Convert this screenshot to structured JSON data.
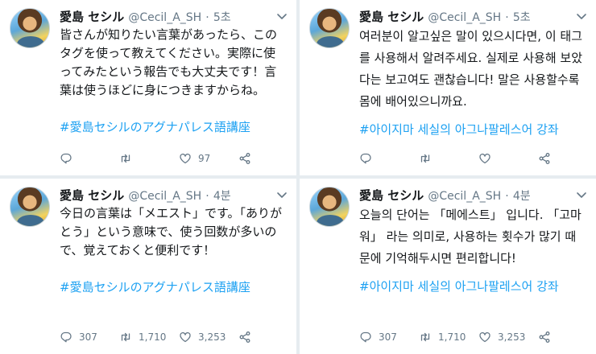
{
  "tweets": [
    {
      "name": "愛島 セシル",
      "handle": "@Cecil_A_SH",
      "dot": "·",
      "time": "5초",
      "lang": "ja",
      "text": "皆さんが知りたい言葉があったら、このタグを使って教えてください。実際に使ってみたという報告でも大丈夫です！言葉は使うほどに身につきますからね。",
      "hashtag": "#愛島セシルのアグナパレス語講座",
      "reply": "",
      "retweet": "",
      "like": "97"
    },
    {
      "name": "愛島 セシル",
      "handle": "@Cecil_A_SH",
      "dot": "·",
      "time": "5초",
      "lang": "ko",
      "text": "여러분이 알고싶은 말이 있으시다면, 이 태그를 사용해서 알려주세요. 실제로 사용해 보았다는 보고여도 괜찮습니다! 말은 사용할수록 몸에 배어있으니까요.",
      "hashtag": "#아이지마 세실의 아그나팔레스어 강좌",
      "reply": "",
      "retweet": "",
      "like": ""
    },
    {
      "name": "愛島 セシル",
      "handle": "@Cecil_A_SH",
      "dot": "·",
      "time": "4분",
      "lang": "ja",
      "text": "今日の言葉は「メエスト」です。「ありがとう」という意味で、使う回数が多いので、覚えておくと便利です！",
      "hashtag": "#愛島セシルのアグナパレス語講座",
      "reply": "307",
      "retweet": "1,710",
      "like": "3,253"
    },
    {
      "name": "愛島 セシル",
      "handle": "@Cecil_A_SH",
      "dot": "·",
      "time": "4분",
      "lang": "ko",
      "text": "오늘의 단어는 「메에스트」 입니다. 「고마워」 라는 의미로, 사용하는 횟수가 많기 때문에 기억해두시면 편리합니다!",
      "hashtag": "#아이지마 세실의 아그나팔레스어 강좌",
      "reply": "307",
      "retweet": "1,710",
      "like": "3,253"
    }
  ],
  "icons": {
    "avatar": "avatar-image",
    "caret": "chevron-down-icon",
    "reply": "reply-icon",
    "retweet": "retweet-icon",
    "like": "heart-icon",
    "share": "share-icon"
  },
  "colors": {
    "background": "#e6ecf0",
    "card": "#ffffff",
    "text": "#14171a",
    "muted": "#657786",
    "link": "#1da1f2"
  }
}
